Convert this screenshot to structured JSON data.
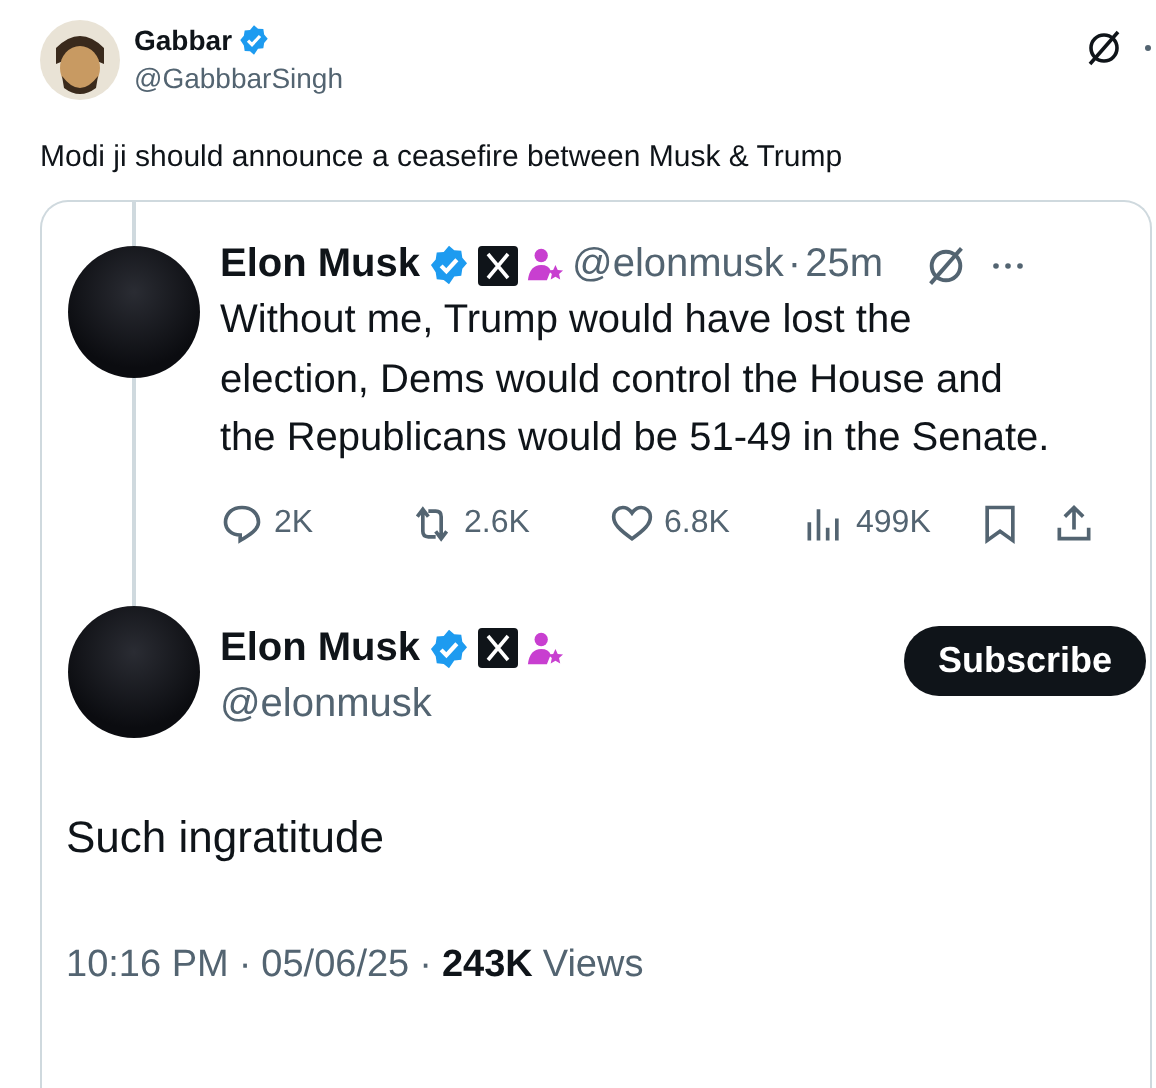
{
  "post": {
    "author": {
      "name": "Gabbar",
      "verified": true,
      "handle": "@GabbbarSingh"
    },
    "text": "Modi ji should announce a ceasefire between Musk & Trump",
    "attached_image": {
      "quoted_post": {
        "author": {
          "name": "Elon Musk",
          "verified": true,
          "handle": "@elonmusk"
        },
        "separator": "·",
        "time": "25m",
        "text": "Without me, Trump would have lost the election, Dems would control the House and the Republicans would be 51-49 in the Senate.",
        "stats": [
          {
            "kind": "reply",
            "count": "2K"
          },
          {
            "kind": "repost",
            "count": "2.6K"
          },
          {
            "kind": "like",
            "count": "6.8K"
          },
          {
            "kind": "views",
            "count": "499K"
          },
          {
            "kind": "bookmark"
          },
          {
            "kind": "share"
          }
        ]
      },
      "reply_post": {
        "author": {
          "name": "Elon Musk",
          "verified": true,
          "handle": "@elonmusk"
        },
        "subscribe_button": "Subscribe",
        "text": "Such ingratitude",
        "time": "10:16 PM",
        "separator": "·",
        "date": "05/06/25",
        "views_count": "243K",
        "views_label": "Views"
      }
    }
  }
}
